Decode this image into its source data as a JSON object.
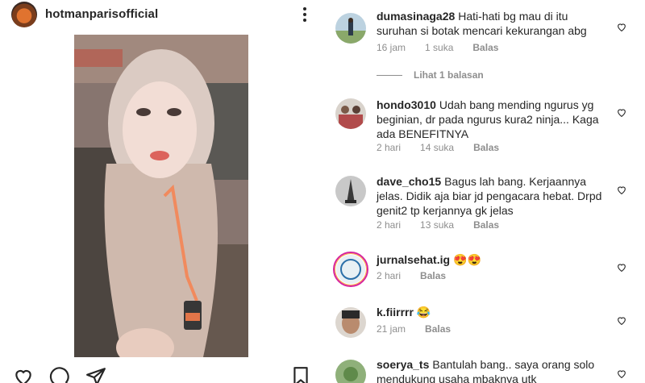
{
  "post": {
    "username": "hotmanparisofficial"
  },
  "comments": [
    {
      "user": "dumasinaga28",
      "text": "Hati-hati bg mau di itu suruhan si botak mencari kekurangan abg",
      "time": "16 jam",
      "likes": "1 suka",
      "reply": "Balas"
    },
    {
      "user": "hondo3010",
      "text": "Udah bang mending ngurus yg beginian, dr pada ngurus kura2 ninja... Kaga ada BENEFITNYA",
      "time": "2 hari",
      "likes": "14 suka",
      "reply": "Balas"
    },
    {
      "user": "dave_cho15",
      "text": "Bagus lah bang. Kerjaannya jelas. Didik aja biar jd pengacara hebat. Drpd genit2 tp kerjannya gk jelas",
      "time": "2 hari",
      "likes": "13 suka",
      "reply": "Balas"
    },
    {
      "user": "jurnalsehat.ig",
      "text": "😍😍",
      "time": "2 hari",
      "reply": "Balas"
    },
    {
      "user": "k.fiirrrr",
      "text": "😂",
      "time": "21 jam",
      "reply": "Balas"
    },
    {
      "user": "soerya_ts",
      "text": "Bantulah bang.. saya orang solo mendukung usaha mbaknya utk"
    }
  ],
  "view_replies": "Lihat 1 balasan",
  "icons": {
    "more": "more-vertical-icon",
    "like": "heart-icon",
    "comment": "comment-icon",
    "share": "share-icon",
    "save": "bookmark-icon"
  }
}
